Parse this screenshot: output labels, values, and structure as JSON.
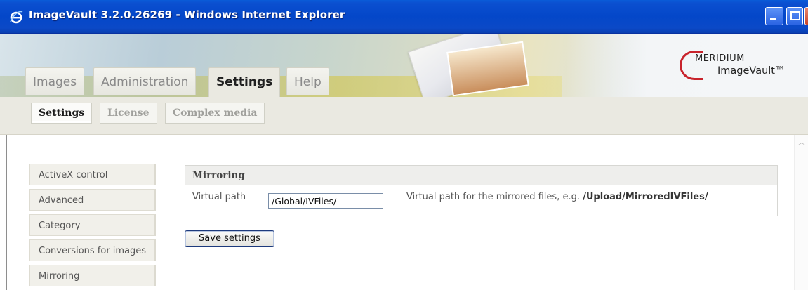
{
  "window": {
    "title": "ImageVault 3.2.0.26269 - Windows Internet Explorer",
    "app_icon": "ie-icon",
    "controls": [
      "minimize-icon",
      "maximize-icon",
      "close-icon"
    ]
  },
  "brand": {
    "company": "MERIDIUM",
    "product": "ImageVault™",
    "accent": "#c8232c"
  },
  "main_tabs": [
    {
      "label": "Images",
      "active": false
    },
    {
      "label": "Administration",
      "active": false
    },
    {
      "label": "Settings",
      "active": true
    },
    {
      "label": "Help",
      "active": false
    }
  ],
  "sub_tabs": [
    {
      "label": "Settings",
      "active": true
    },
    {
      "label": "License",
      "active": false
    },
    {
      "label": "Complex media",
      "active": false
    }
  ],
  "sidebar": {
    "items": [
      {
        "label": "ActiveX control"
      },
      {
        "label": "Advanced"
      },
      {
        "label": "Category"
      },
      {
        "label": "Conversions for images"
      },
      {
        "label": "Mirroring"
      }
    ]
  },
  "panel": {
    "title": "Mirroring",
    "field_label": "Virtual path",
    "field_value": "/Global/IVFiles/",
    "help_prefix": "Virtual path for the mirrored files, e.g.",
    "help_example": "/Upload/MirroredIVFiles/"
  },
  "actions": {
    "save_label": "Save settings"
  }
}
